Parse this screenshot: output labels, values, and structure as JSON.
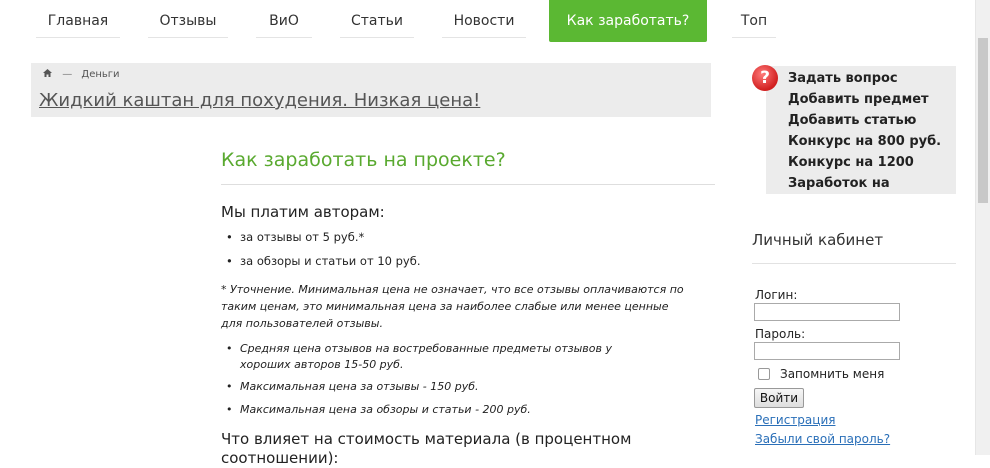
{
  "nav": {
    "items": [
      "Главная",
      "Отзывы",
      "ВиО",
      "Статьи",
      "Новости",
      "Как заработать?",
      "Топ"
    ]
  },
  "breadcrumb": {
    "home_icon": "home-icon",
    "separator": "—",
    "section": "Деньги"
  },
  "ad": {
    "link": "Жидкий каштан для похудения. Низкая цена!"
  },
  "main": {
    "title": "Как заработать на проекте?",
    "pay_heading": "Мы платим авторам:",
    "pay_items": [
      "за отзывы от 5 руб.*",
      "за обзоры и статьи от 10 руб."
    ],
    "note": "* Уточнение. Минимальная цена не означает, что все отзывы оплачиваются по таким ценам, это минимальная цена за наиболее слабые или менее ценные для пользователей отзывы.",
    "price_items": [
      "Средняя цена отзывов на востребованные предметы отзывов у хороших авторов 15-50 руб.",
      "Максимальная цена за отзывы - 150 руб.",
      "Максимальная цена за обзоры и статьи - 200 руб."
    ],
    "factors_heading": "Что влияет на стоимость материала (в процентном соотношении):"
  },
  "sidebar": {
    "question_icon": "question-mark-icon",
    "links": [
      "Задать вопрос",
      "Добавить предмет",
      "Добавить статью",
      "Конкурс на 800 руб.",
      "Конкурс на 1200",
      "Заработок на"
    ],
    "cabinet_title": "Личный кабинет",
    "login_label": "Логин:",
    "password_label": "Пароль:",
    "remember_label": "Запомнить меня",
    "submit_label": "Войти",
    "register_link": "Регистрация",
    "forgot_link": "Забыли свой пароль?"
  },
  "colors": {
    "accent_green": "#5bb833",
    "title_green": "#59a92f",
    "link_blue": "#2a6fb8",
    "question_red": "#d11f1f"
  }
}
